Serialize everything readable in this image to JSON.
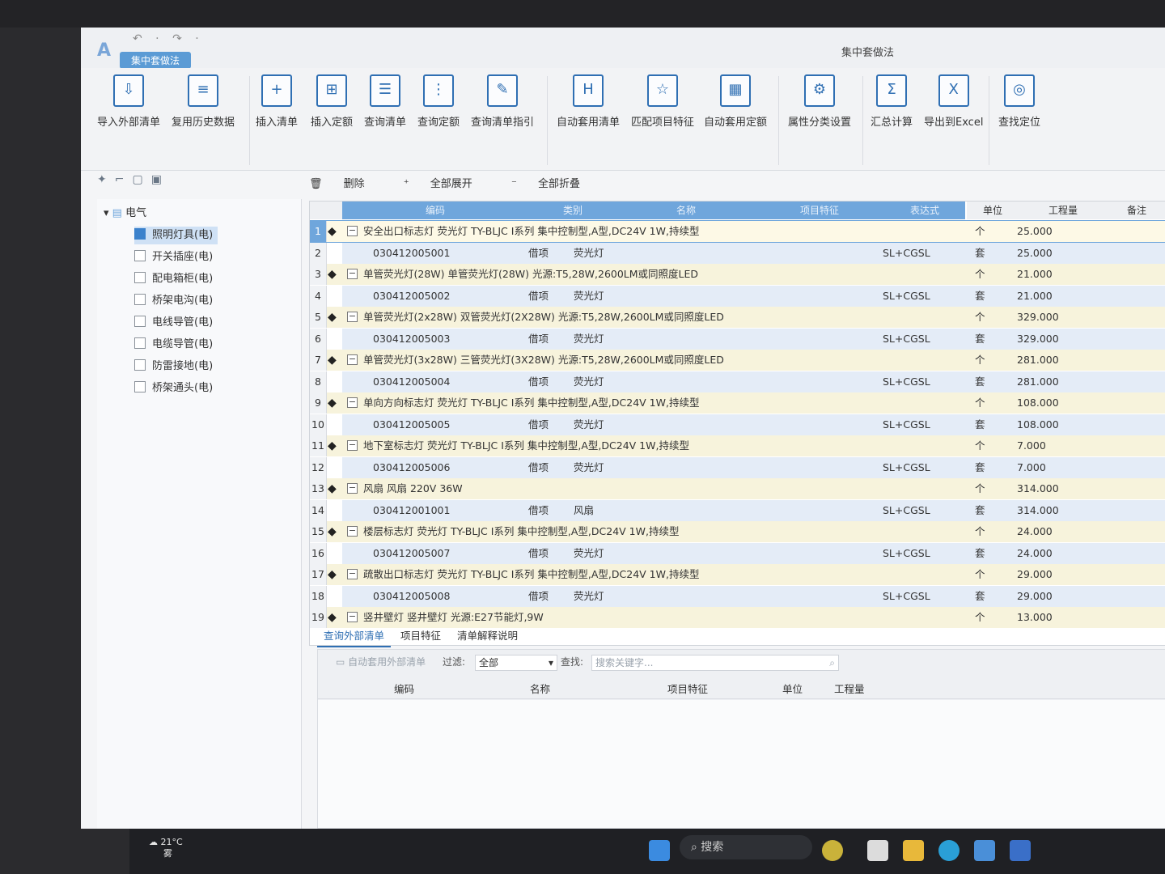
{
  "window": {
    "title": "集中套做法",
    "app_tab": "集中套做法",
    "undo_icons": "↶ · ↷ ·"
  },
  "ribbon": {
    "buttons": [
      {
        "label": "导入外部清单",
        "icon": "import-list-icon"
      },
      {
        "label": "复用历史数据",
        "icon": "history-data-icon"
      },
      {
        "label": "插入清单",
        "icon": "insert-list-icon"
      },
      {
        "label": "插入定额",
        "icon": "insert-quota-icon"
      },
      {
        "label": "查询清单",
        "icon": "query-list-icon"
      },
      {
        "label": "查询定额",
        "icon": "query-quota-icon"
      },
      {
        "label": "查询清单指引",
        "icon": "list-guide-icon"
      },
      {
        "label": "自动套用清单",
        "icon": "auto-apply-list-icon"
      },
      {
        "label": "匹配项目特征",
        "icon": "match-feature-icon"
      },
      {
        "label": "自动套用定额",
        "icon": "auto-apply-quota-icon"
      },
      {
        "label": "属性分类设置",
        "icon": "attr-category-icon"
      },
      {
        "label": "汇总计算",
        "icon": "sum-icon"
      },
      {
        "label": "导出到Excel",
        "icon": "excel-export-icon"
      },
      {
        "label": "查找定位",
        "icon": "locate-icon"
      }
    ]
  },
  "tree": {
    "root": "电气",
    "items": [
      {
        "label": "照明灯具(电)",
        "checked": true
      },
      {
        "label": "开关插座(电)",
        "checked": false
      },
      {
        "label": "配电箱柜(电)",
        "checked": false
      },
      {
        "label": "桥架电沟(电)",
        "checked": false
      },
      {
        "label": "电线导管(电)",
        "checked": false
      },
      {
        "label": "电缆导管(电)",
        "checked": false
      },
      {
        "label": "防雷接地(电)",
        "checked": false
      },
      {
        "label": "桥架通头(电)",
        "checked": false
      }
    ]
  },
  "toolbar": {
    "delete": "删除",
    "expand_all": "全部展开",
    "collapse_all": "全部折叠"
  },
  "grid": {
    "headers": {
      "code": "编码",
      "category": "类别",
      "name": "名称",
      "feature": "项目特征",
      "expr": "表达式",
      "unit": "单位",
      "qty": "工程量",
      "remark": "备注"
    },
    "rows": [
      {
        "n": "1",
        "type": "parent",
        "name": "安全出口标志灯 荧光灯 TY-BLJC I系列 集中控制型,A型,DC24V 1W,持续型",
        "unit": "个",
        "qty": "25.000"
      },
      {
        "n": "2",
        "type": "child",
        "code": "030412005001",
        "cat": "借项",
        "name": "荧光灯",
        "expr": "SL+CGSL",
        "unit": "套",
        "qty": "25.000"
      },
      {
        "n": "3",
        "type": "parent",
        "name": "单管荧光灯(28W) 单管荧光灯(28W) 光源:T5,28W,2600LM或同照度LED",
        "unit": "个",
        "qty": "21.000"
      },
      {
        "n": "4",
        "type": "child",
        "code": "030412005002",
        "cat": "借项",
        "name": "荧光灯",
        "expr": "SL+CGSL",
        "unit": "套",
        "qty": "21.000"
      },
      {
        "n": "5",
        "type": "parent",
        "name": "单管荧光灯(2x28W) 双管荧光灯(2X28W) 光源:T5,28W,2600LM或同照度LED",
        "unit": "个",
        "qty": "329.000"
      },
      {
        "n": "6",
        "type": "child",
        "code": "030412005003",
        "cat": "借项",
        "name": "荧光灯",
        "expr": "SL+CGSL",
        "unit": "套",
        "qty": "329.000"
      },
      {
        "n": "7",
        "type": "parent",
        "name": "单管荧光灯(3x28W) 三管荧光灯(3X28W) 光源:T5,28W,2600LM或同照度LED",
        "unit": "个",
        "qty": "281.000"
      },
      {
        "n": "8",
        "type": "child",
        "code": "030412005004",
        "cat": "借项",
        "name": "荧光灯",
        "expr": "SL+CGSL",
        "unit": "套",
        "qty": "281.000"
      },
      {
        "n": "9",
        "type": "parent",
        "name": "单向方向标志灯 荧光灯 TY-BLJC I系列 集中控制型,A型,DC24V 1W,持续型",
        "unit": "个",
        "qty": "108.000"
      },
      {
        "n": "10",
        "type": "child",
        "code": "030412005005",
        "cat": "借项",
        "name": "荧光灯",
        "expr": "SL+CGSL",
        "unit": "套",
        "qty": "108.000"
      },
      {
        "n": "11",
        "type": "parent",
        "name": "地下室标志灯 荧光灯 TY-BLJC I系列 集中控制型,A型,DC24V 1W,持续型",
        "unit": "个",
        "qty": "7.000"
      },
      {
        "n": "12",
        "type": "child",
        "code": "030412005006",
        "cat": "借项",
        "name": "荧光灯",
        "expr": "SL+CGSL",
        "unit": "套",
        "qty": "7.000"
      },
      {
        "n": "13",
        "type": "parent",
        "name": "风扇 风扇 220V 36W",
        "unit": "个",
        "qty": "314.000"
      },
      {
        "n": "14",
        "type": "child",
        "code": "030412001001",
        "cat": "借项",
        "name": "风扇",
        "expr": "SL+CGSL",
        "unit": "套",
        "qty": "314.000"
      },
      {
        "n": "15",
        "type": "parent",
        "name": "楼层标志灯 荧光灯 TY-BLJC I系列 集中控制型,A型,DC24V 1W,持续型",
        "unit": "个",
        "qty": "24.000"
      },
      {
        "n": "16",
        "type": "child",
        "code": "030412005007",
        "cat": "借项",
        "name": "荧光灯",
        "expr": "SL+CGSL",
        "unit": "套",
        "qty": "24.000"
      },
      {
        "n": "17",
        "type": "parent",
        "name": "疏散出口标志灯 荧光灯 TY-BLJC I系列 集中控制型,A型,DC24V 1W,持续型",
        "unit": "个",
        "qty": "29.000"
      },
      {
        "n": "18",
        "type": "child",
        "code": "030412005008",
        "cat": "借项",
        "name": "荧光灯",
        "expr": "SL+CGSL",
        "unit": "套",
        "qty": "29.000"
      },
      {
        "n": "19",
        "type": "parent",
        "name": "竖井壁灯 竖井壁灯 光源:E27节能灯,9W",
        "unit": "个",
        "qty": "13.000"
      }
    ]
  },
  "bottom": {
    "tabs": [
      "查询外部清单",
      "项目特征",
      "清单解释说明"
    ],
    "auto_apply": "自动套用外部清单",
    "filter_label": "过滤:",
    "filter_value": "全部",
    "search_label": "查找:",
    "search_placeholder": "搜索关键字...",
    "headers": [
      "编码",
      "名称",
      "项目特征",
      "单位",
      "工程量"
    ]
  },
  "taskbar": {
    "temp": "21°C",
    "weather": "雾",
    "search": "搜索"
  }
}
